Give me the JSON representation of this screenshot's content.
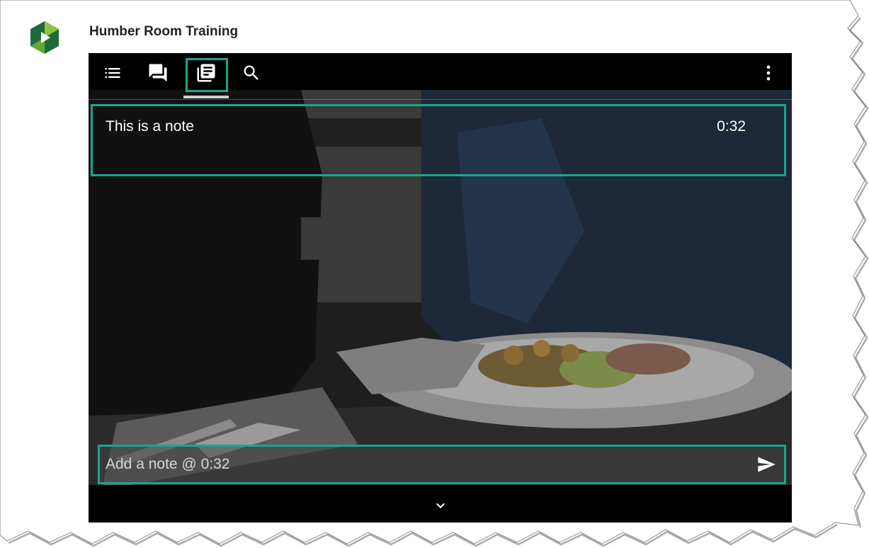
{
  "app": {
    "title": "Humber Room Training"
  },
  "toolbar": {
    "items": [
      {
        "icon": "list-icon",
        "label": "Contents"
      },
      {
        "icon": "comments-icon",
        "label": "Discussion"
      },
      {
        "icon": "notes-icon",
        "label": "Notes",
        "active": true
      },
      {
        "icon": "search-icon",
        "label": "Search"
      }
    ],
    "more_icon": "more-vertical-icon"
  },
  "notes": {
    "items": [
      {
        "text": "This is a note",
        "time": "0:32"
      }
    ],
    "input": {
      "value": "",
      "placeholder": "Add a note @ 0:32"
    },
    "send_icon": "send-icon"
  },
  "collapse_icon": "chevron-down-icon",
  "colors": {
    "accent": "#1aa58e",
    "toolbar_bg": "#000000",
    "text": "#ffffff",
    "logo_green_dark": "#1e6b3a",
    "logo_green_light": "#8cc63f"
  }
}
